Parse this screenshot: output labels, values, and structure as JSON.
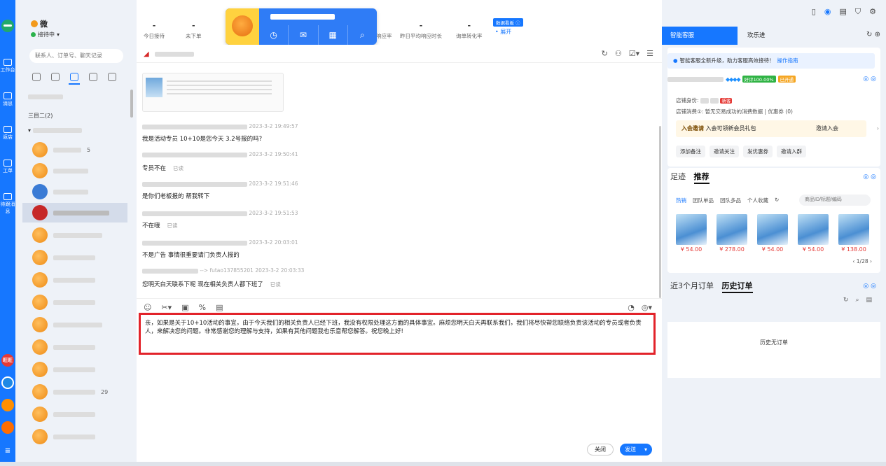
{
  "brand": {
    "name": "微",
    "status": "接待中"
  },
  "search": {
    "placeholder": "联系人、订单号、聊天记录"
  },
  "sidebar": {
    "items": [
      {
        "label": "工作台"
      },
      {
        "label": "消息"
      },
      {
        "label": "返店"
      },
      {
        "label": "工单"
      },
      {
        "label": "待跟消息"
      }
    ],
    "apps": [
      "旺旺",
      "",
      "",
      ""
    ]
  },
  "contacts": {
    "group_label": "三目二(2)",
    "last_item_suffix": "29",
    "row_suffix": "5"
  },
  "stats": [
    {
      "value": "-",
      "label": "今日接待"
    },
    {
      "value": "-",
      "label": "未下单"
    },
    {
      "value": "-",
      "label": "昨日平均响应时长"
    },
    {
      "value": "-",
      "label": "询单转化率"
    }
  ],
  "topbar": {
    "badge": "数据看板 ⓘ",
    "expand": "展开",
    "extra_label": "响应率"
  },
  "messages": [
    {
      "meta": "2023-3-2 19:49:57",
      "text": "我是活动专员 10+10是您今天 3.2号报的吗?",
      "read": ""
    },
    {
      "meta": "2023-3-2 19:50:41",
      "text": "专员不在",
      "read": "已读"
    },
    {
      "meta": "2023-3-2 19:51:46",
      "text": "是你们老板报的 帮我转下",
      "read": ""
    },
    {
      "meta": "2023-3-2 19:51:53",
      "text": "不在哦",
      "read": "已读"
    },
    {
      "meta": "2023-3-2 20:03:01",
      "text": "不是广告 事情很重要请门负责人报的",
      "read": ""
    },
    {
      "meta": "--> futao137855201  2023-3-2 20:03:33",
      "text": "您明天白天联系下呢  现在相关负责人都下班了",
      "read": "已读"
    }
  ],
  "reply": {
    "text": "亲，如果是关于10+10活动的事宜，由于今天我们的相关负责人已经下班，我没有权限处理这方面的具体事宜。麻烦您明天白天再联系我们，我们将尽快帮您联络负责该活动的专员或者负责人，来解决您的问题。非常感谢您的理解与支持，如果有其他问题我也乐意帮您解答。祝您晚上好!"
  },
  "buttons": {
    "close": "关闭",
    "send": "发送"
  },
  "right": {
    "tabs": [
      "智能客服",
      "欢乐进"
    ],
    "notice": "智能客服全新升级，助力客服高效接待！",
    "notice_link": "操作指南",
    "good_rate": "好评100.00%",
    "tag_o": "已开通",
    "shop_identity_label": "店铺身份:",
    "shop_identity_tag": "新客",
    "shop_consume": "店铺消费①: 暂无交易成功的消费数据 | 优惠券 (0)",
    "vip": "入会邀请",
    "vip_desc": "入会可领新会员礼包",
    "vip_invite": "邀请入会",
    "actions": [
      "添加备注",
      "邀请关注",
      "发优惠券",
      "邀请入群"
    ],
    "footprint_title": "足迹",
    "recommend_title": "推荐",
    "filters": [
      "热销",
      "团队单品",
      "团队多品",
      "个人收藏"
    ],
    "product_search": "商品ID/标题/编码",
    "prices": [
      "¥ 54.00",
      "¥ 278.00",
      "¥ 54.00",
      "¥ 54.00",
      "¥ 138.00"
    ],
    "pager": "1/28",
    "orders_title": "近3个月订单",
    "history_title": "历史订单",
    "empty": "历史无订单"
  }
}
